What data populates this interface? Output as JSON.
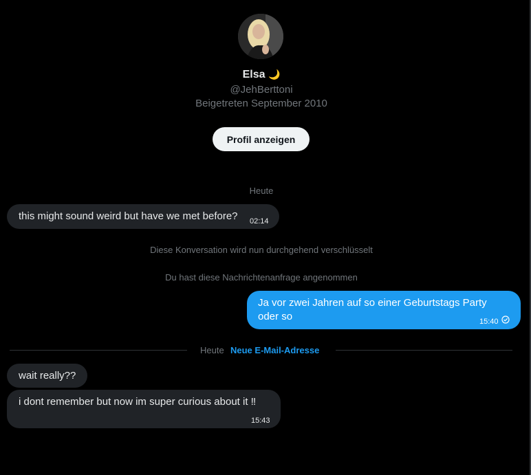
{
  "profile": {
    "name": "Elsa",
    "name_emoji": "🌙",
    "handle": "@JehBerttoni",
    "joined": "Beigetreten September 2010",
    "view_profile_label": "Profil anzeigen"
  },
  "conversation": {
    "date_label_top": "Heute",
    "messages": [
      {
        "direction": "incoming",
        "text": "this might sound weird but have we met before?",
        "time": "02:14"
      },
      {
        "direction": "outgoing",
        "text_line1": "Ja vor zwei Jahren auf so einer Geburtstags Party",
        "text_line2": "oder so",
        "time": "15:40",
        "status": "read"
      },
      {
        "direction": "incoming",
        "text": "wait really??"
      },
      {
        "direction": "incoming",
        "text": "i dont remember but now im super curious about it ‼",
        "time": "15:43"
      }
    ],
    "system_notices": [
      "Diese Konversation wird nun durchgehend verschlüsselt",
      "Du hast diese Nachrichtenanfrage angenommen"
    ],
    "divider": {
      "label": "Heute",
      "link": "Neue E-Mail-Adresse"
    }
  },
  "colors": {
    "background": "#000000",
    "incoming_bubble": "#202327",
    "outgoing_bubble": "#1d9bf0",
    "muted_text": "#71767b",
    "accent": "#1d9bf0"
  }
}
